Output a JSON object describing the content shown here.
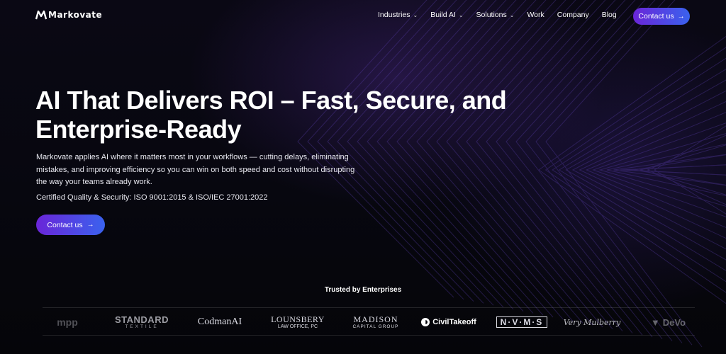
{
  "brand": {
    "name": "Markovate",
    "logo_icon": "markovate-logo-icon"
  },
  "nav": {
    "items": [
      {
        "label": "Industries",
        "has_dropdown": true
      },
      {
        "label": "Build AI",
        "has_dropdown": true
      },
      {
        "label": "Solutions",
        "has_dropdown": true
      },
      {
        "label": "Work",
        "has_dropdown": false
      },
      {
        "label": "Company",
        "has_dropdown": false
      },
      {
        "label": "Blog",
        "has_dropdown": false
      }
    ],
    "cta_label": "Contact us",
    "cta_icon": "arrow-right-icon"
  },
  "hero": {
    "title_line1": "AI That Delivers ROI – Fast, Secure, and",
    "title_line2": "Enterprise-Ready",
    "description": "Markovate applies AI where it matters most in your workflows — cutting delays, eliminating mistakes, and improving efficiency so you can win on both speed and cost without disrupting the way your teams already work.",
    "certification": "Certified Quality & Security: ISO 9001:2015 & ISO/IEC 27001:2022",
    "cta_label": "Contact us"
  },
  "trust": {
    "heading": "Trusted by Enterprises",
    "clients": {
      "mpp": "mpp",
      "standard_l1": "STANDARD",
      "standard_l2": "TEXTILE",
      "codman": "CodmanAI",
      "lounsbery_l1": "LOUNSBERY",
      "lounsbery_l2": "LAW OFFICE, PC",
      "madison_l1": "MADISON",
      "madison_l2": "CAPITAL GROUP",
      "civiltakeoff": "CivilTakeoff",
      "nvms": "N·V·M·S",
      "very_mulberry": "Very Mulberry",
      "devo": "DeVo"
    }
  },
  "colors": {
    "background": "#06060c",
    "cta_gradient_start": "#6a25d8",
    "cta_gradient_end": "#3a62ee",
    "text": "#ffffff"
  }
}
